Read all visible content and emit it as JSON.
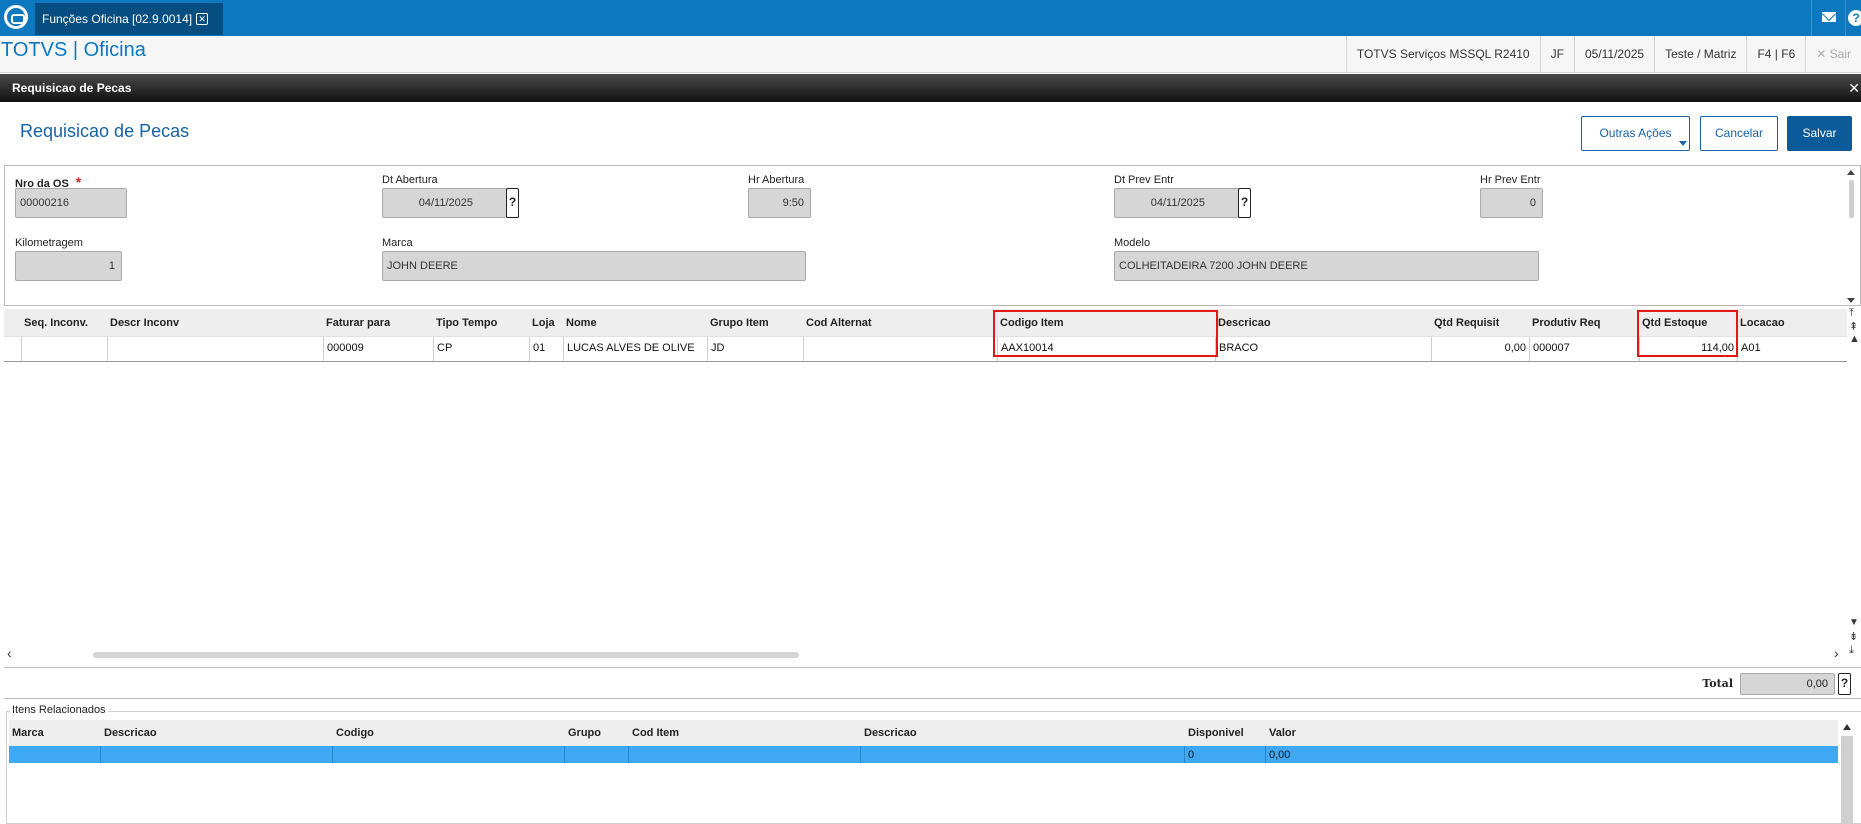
{
  "tab": {
    "label": "Funções Oficina [02.9.0014]"
  },
  "app": {
    "title": "TOTVS | Oficina"
  },
  "status": {
    "environment": "TOTVS Serviços MSSQL R2410",
    "user": "JF",
    "date": "05/11/2025",
    "company": "Teste / Matriz",
    "keys": "F4 | F6",
    "exit": "Sair"
  },
  "dialog": {
    "title": "Requisicao de Pecas"
  },
  "page": {
    "title": "Requisicao de Pecas"
  },
  "actions": {
    "more": "Outras Ações",
    "cancel": "Cancelar",
    "save": "Salvar"
  },
  "form": {
    "os_number": {
      "label": "Nro da OS",
      "required_mark": "*",
      "value": "00000216"
    },
    "open_date": {
      "label": "Dt Abertura",
      "value": "04/11/2025"
    },
    "open_time": {
      "label": "Hr Abertura",
      "value": "9:50"
    },
    "due_date": {
      "label": "Dt Prev Entr",
      "value": "04/11/2025"
    },
    "due_time": {
      "label": "Hr Prev Entr",
      "value": "0"
    },
    "mileage": {
      "label": "Kilometragem",
      "value": "1"
    },
    "brand": {
      "label": "Marca",
      "value": "JOHN DEERE"
    },
    "model": {
      "label": "Modelo",
      "value": "COLHEITADEIRA 7200  JOHN DEERE"
    },
    "lookup_button": "?"
  },
  "grid": {
    "columns": [
      "Seq. Inconv.",
      "Descr Inconv",
      "Faturar para",
      "Tipo Tempo",
      "Loja",
      "Nome",
      "Grupo Item",
      "Cod Alternat",
      "Codigo Item",
      "Descricao",
      "Qtd Requisit",
      "Produtiv Req",
      "Qtd Estoque",
      "Locacao"
    ],
    "rows": [
      [
        "",
        "",
        "000009",
        "CP",
        "01",
        "LUCAS ALVES DE OLIVE",
        "JD",
        "",
        "AAX10014",
        "BRACO",
        "0,00",
        "000007",
        "114,00",
        "A01"
      ]
    ],
    "highlighted_columns": [
      "Codigo Item",
      "Qtd Estoque"
    ]
  },
  "total": {
    "label": "Total",
    "value": "0,00"
  },
  "related": {
    "legend": "Itens Relacionados",
    "columns": [
      "Marca",
      "Descricao",
      "Codigo",
      "Grupo",
      "Cod Item",
      "Descricao",
      "Disponivel",
      "Valor"
    ],
    "rows": [
      [
        "",
        "",
        "",
        "",
        "",
        "",
        "0",
        "0,00"
      ]
    ]
  },
  "colors": {
    "topbar": "#0c78c0",
    "primary": "#0b5a9a",
    "selected_row": "#3ea8f4",
    "highlight": "#e01818"
  }
}
